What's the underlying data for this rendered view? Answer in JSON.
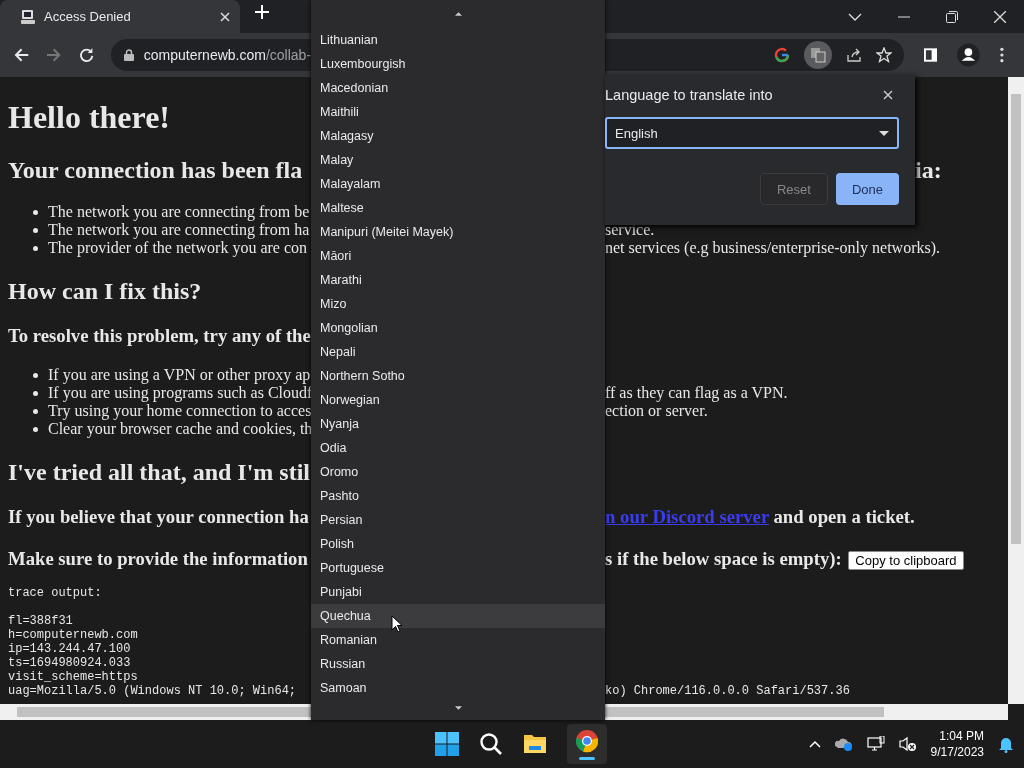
{
  "tabs": [
    {
      "title": "Access Denied",
      "selected": true
    }
  ],
  "address": {
    "host": "computernewb.com",
    "path": "/collab-"
  },
  "page": {
    "rows": [
      {
        "kind": "h1",
        "left": "Hello there!"
      },
      {
        "kind": "h2",
        "left": "Your connection has been fla",
        "right": "ia:"
      },
      {
        "kind": "bullet",
        "left": "The network you are connecting from be"
      },
      {
        "kind": "bullet",
        "left": "The network you are connecting from ha",
        "right": "service."
      },
      {
        "kind": "bullet",
        "left": "The provider of the network you are con",
        "right": "net services (e.g business/enterprise-only networks)."
      },
      {
        "kind": "h2",
        "left": "How can I fix this?"
      },
      {
        "kind": "h3",
        "left": "To resolve this problem, try any of the"
      },
      {
        "kind": "bullet",
        "left": "If you are using a VPN or other proxy ap"
      },
      {
        "kind": "bullet",
        "left": "If you are using programs such as Cloudf",
        "right": "ff as they can flag as a VPN."
      },
      {
        "kind": "bullet",
        "left": "Try using your home connection to acces",
        "right": "ection or server."
      },
      {
        "kind": "bullet",
        "left": "Clear your browser cache and cookies, th"
      },
      {
        "kind": "h2",
        "left": "I've tried all that, and I'm stil"
      },
      {
        "kind": "h3",
        "left": "If you believe that your connection ha",
        "link": "n our Discord server",
        "right": " and open a ticket."
      },
      {
        "kind": "h3",
        "left": "Make sure to provide the information",
        "right": "s if the below space is empty):",
        "button": "Copy to clipboard"
      },
      {
        "kind": "pre",
        "left": "trace output:"
      },
      {
        "kind": "gap"
      },
      {
        "kind": "pre",
        "left": "fl=388f31"
      },
      {
        "kind": "pre",
        "left": "h=computernewb.com"
      },
      {
        "kind": "pre",
        "left": "ip=143.244.47.100"
      },
      {
        "kind": "pre",
        "left": "ts=1694980924.033"
      },
      {
        "kind": "pre",
        "left": "visit_scheme=https"
      },
      {
        "kind": "pre",
        "left": "uag=Mozilla/5.0 (Windows NT 10.0; Win64;",
        "right": "ko) Chrome/116.0.0.0 Safari/537.36"
      }
    ]
  },
  "dropdown": {
    "items": [
      {
        "label": "Lithuanian",
        "selected": false
      },
      {
        "label": "Luxembourgish",
        "selected": false
      },
      {
        "label": "Macedonian",
        "selected": false
      },
      {
        "label": "Maithili",
        "selected": false
      },
      {
        "label": "Malagasy",
        "selected": false
      },
      {
        "label": "Malay",
        "selected": false
      },
      {
        "label": "Malayalam",
        "selected": false
      },
      {
        "label": "Maltese",
        "selected": false
      },
      {
        "label": "Manipuri (Meitei Mayek)",
        "selected": false
      },
      {
        "label": "Māori",
        "selected": false
      },
      {
        "label": "Marathi",
        "selected": false
      },
      {
        "label": "Mizo",
        "selected": false
      },
      {
        "label": "Mongolian",
        "selected": false
      },
      {
        "label": "Nepali",
        "selected": false
      },
      {
        "label": "Northern Sotho",
        "selected": false
      },
      {
        "label": "Norwegian",
        "selected": false
      },
      {
        "label": "Nyanja",
        "selected": false
      },
      {
        "label": "Odia",
        "selected": false
      },
      {
        "label": "Oromo",
        "selected": false
      },
      {
        "label": "Pashto",
        "selected": false
      },
      {
        "label": "Persian",
        "selected": false
      },
      {
        "label": "Polish",
        "selected": false
      },
      {
        "label": "Portuguese",
        "selected": false
      },
      {
        "label": "Punjabi",
        "selected": false
      },
      {
        "label": "Quechua",
        "selected": true
      },
      {
        "label": "Romanian",
        "selected": false
      },
      {
        "label": "Russian",
        "selected": false
      },
      {
        "label": "Samoan",
        "selected": false
      }
    ]
  },
  "translate_popup": {
    "title": "Language to translate into",
    "language": "English",
    "buttons": [
      {
        "label": "Reset",
        "kind": "secondary"
      },
      {
        "label": "Done",
        "kind": "primary"
      }
    ]
  },
  "taskbar": {
    "time": "1:04 PM",
    "date": "9/17/2023"
  }
}
